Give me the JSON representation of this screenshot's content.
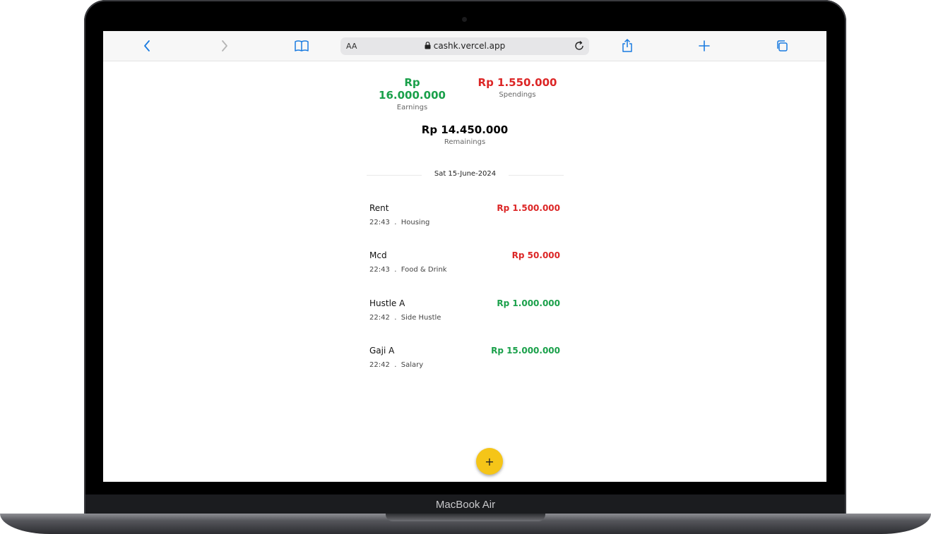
{
  "device": {
    "brand_label": "MacBook Air"
  },
  "browser": {
    "text_size_label": "AA",
    "url": "cashk.vercel.app",
    "icons": [
      "back-icon",
      "forward-icon",
      "bookmarks-icon",
      "lock-icon",
      "reload-icon",
      "share-icon",
      "new-tab-icon",
      "tabs-icon"
    ]
  },
  "summary": {
    "earnings": {
      "value": "Rp 16.000.000",
      "label": "Earnings",
      "color": "#1aa04a"
    },
    "spendings": {
      "value": "Rp 1.550.000",
      "label": "Spendings",
      "color": "#dc2626"
    },
    "remainings": {
      "value": "Rp 14.450.000",
      "label": "Remainings"
    }
  },
  "date_header": "Sat 15-June-2024",
  "transactions": [
    {
      "name": "Rent",
      "time": "22:43",
      "sep": ".",
      "category": "Housing",
      "amount": "Rp 1.500.000",
      "type": "spending"
    },
    {
      "name": "Mcd",
      "time": "22:43",
      "sep": ".",
      "category": "Food & Drink",
      "amount": "Rp 50.000",
      "type": "spending"
    },
    {
      "name": "Hustle A",
      "time": "22:42",
      "sep": ".",
      "category": "Side Hustle",
      "amount": "Rp 1.000.000",
      "type": "earning"
    },
    {
      "name": "Gaji A",
      "time": "22:42",
      "sep": ".",
      "category": "Salary",
      "amount": "Rp 15.000.000",
      "type": "earning"
    }
  ],
  "fab": {
    "label": "+",
    "accent": "#f5c518"
  }
}
